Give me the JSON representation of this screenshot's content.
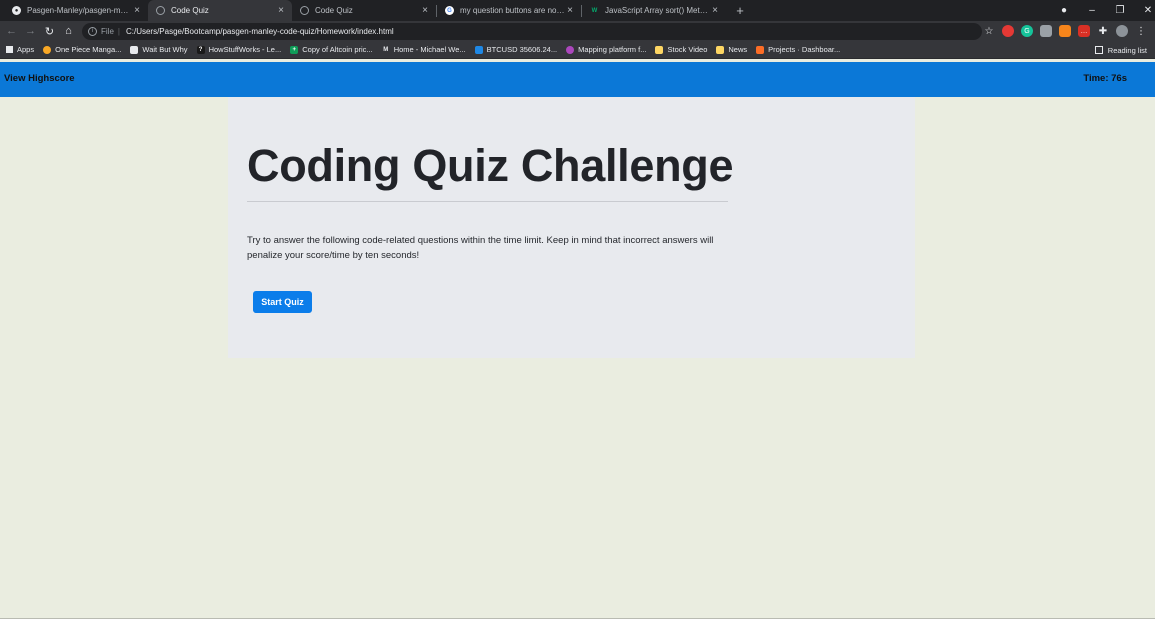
{
  "browser": {
    "tabs": [
      {
        "title": "Pasgen-Manley/pasgen-manley-",
        "icon": "github-icon"
      },
      {
        "title": "Code Quiz",
        "icon": "globe-icon"
      },
      {
        "title": "Code Quiz",
        "icon": "globe-icon"
      },
      {
        "title": "my question buttons are not sta",
        "icon": "google-icon"
      },
      {
        "title": "JavaScript Array sort() Method",
        "icon": "w3schools-icon"
      }
    ],
    "active_tab": 1,
    "address_bar": {
      "scheme": "File",
      "url": "C:/Users/Pasge/Bootcamp/pasgen-manley-code-quiz/Homework/index.html"
    },
    "bookmarks": [
      {
        "label": "Apps",
        "icon": "apps-grid-icon"
      },
      {
        "label": "One Piece Manga...",
        "icon": "one-piece-icon"
      },
      {
        "label": "Wait But Why",
        "icon": "waitbutwhy-icon"
      },
      {
        "label": "HowStuffWorks - Le...",
        "icon": "howstuffworks-icon"
      },
      {
        "label": "Copy of Altcoin pric...",
        "icon": "sheets-icon"
      },
      {
        "label": "Home - Michael We...",
        "icon": "medium-icon"
      },
      {
        "label": "BTCUSD 35606.24...",
        "icon": "tradingview-icon"
      },
      {
        "label": "Mapping platform f...",
        "icon": "mapping-icon"
      },
      {
        "label": "Stock Video",
        "icon": "folder-icon"
      },
      {
        "label": "News",
        "icon": "folder-icon"
      },
      {
        "label": "Projects · Dashboar...",
        "icon": "gitlab-icon"
      }
    ],
    "reading_list": "Reading list"
  },
  "page": {
    "header": {
      "highscore_link": "View Highscore",
      "timer": "Time: 76s"
    },
    "title": "Coding Quiz Challenge",
    "description": "Try to answer the following code-related questions within the time limit. Keep in mind that incorrect answers will penalize your score/time by ten seconds!",
    "start_button": "Start Quiz"
  },
  "colors": {
    "header_bar": "#0b78d7",
    "page_bg": "#eaede0",
    "jumbotron_bg": "#e8eaee",
    "button": "#0b7dea"
  }
}
